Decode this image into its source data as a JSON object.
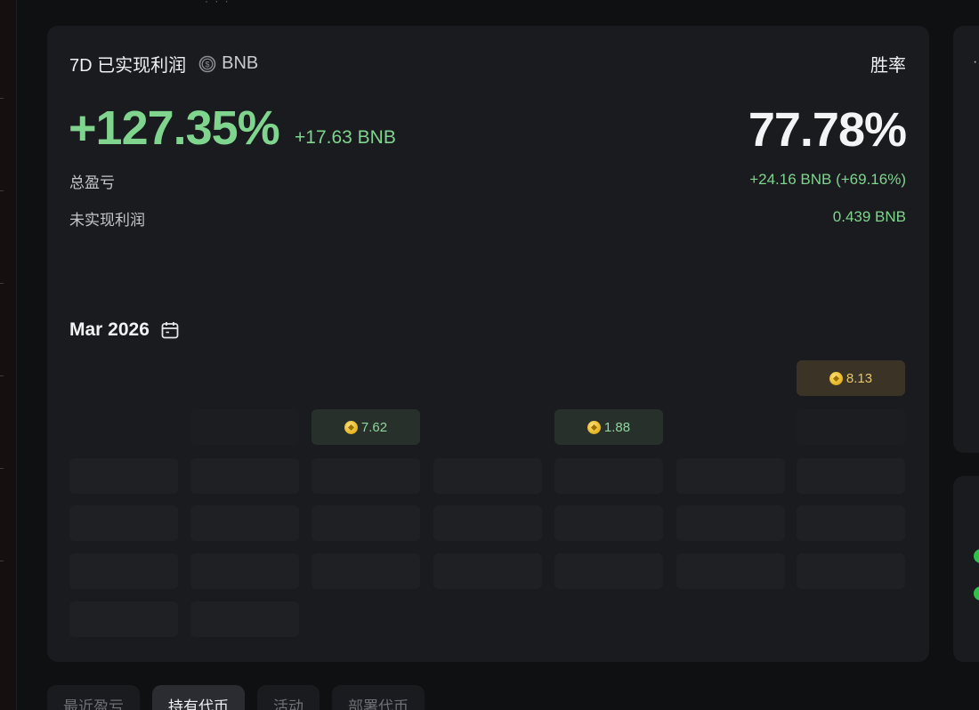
{
  "header": {
    "title": "7D 已实现利润",
    "currency": "BNB",
    "win_rate_label": "胜率"
  },
  "summary": {
    "realized_pct": "+127.35%",
    "realized_amount": "+17.63 BNB",
    "win_rate": "77.78%",
    "total_pnl_label": "总盈亏",
    "total_pnl_value": "+24.16 BNB (+69.16%)",
    "unrealized_label": "未实现利润",
    "unrealized_value": "0.439 BNB"
  },
  "calendar": {
    "month": "Mar 2026",
    "cells": [
      {
        "row": 0,
        "col": 6,
        "value": "8.13",
        "kind": "hi"
      },
      {
        "row": 1,
        "col": 1,
        "value": "",
        "kind": "faint"
      },
      {
        "row": 1,
        "col": 2,
        "value": "7.62",
        "kind": "pos"
      },
      {
        "row": 1,
        "col": 4,
        "value": "1.88",
        "kind": "pos"
      },
      {
        "row": 1,
        "col": 6,
        "value": "",
        "kind": "faint"
      },
      {
        "row": 2,
        "col": 0,
        "value": "",
        "kind": "empty"
      },
      {
        "row": 2,
        "col": 1,
        "value": "",
        "kind": "empty"
      },
      {
        "row": 2,
        "col": 2,
        "value": "",
        "kind": "empty"
      },
      {
        "row": 2,
        "col": 3,
        "value": "",
        "kind": "empty"
      },
      {
        "row": 2,
        "col": 4,
        "value": "",
        "kind": "empty"
      },
      {
        "row": 2,
        "col": 5,
        "value": "",
        "kind": "empty"
      },
      {
        "row": 2,
        "col": 6,
        "value": "",
        "kind": "empty"
      },
      {
        "row": 3,
        "col": 0,
        "value": "",
        "kind": "empty"
      },
      {
        "row": 3,
        "col": 1,
        "value": "",
        "kind": "empty"
      },
      {
        "row": 3,
        "col": 2,
        "value": "",
        "kind": "empty"
      },
      {
        "row": 3,
        "col": 3,
        "value": "",
        "kind": "empty"
      },
      {
        "row": 3,
        "col": 4,
        "value": "",
        "kind": "empty"
      },
      {
        "row": 3,
        "col": 5,
        "value": "",
        "kind": "empty"
      },
      {
        "row": 3,
        "col": 6,
        "value": "",
        "kind": "empty"
      },
      {
        "row": 4,
        "col": 0,
        "value": "",
        "kind": "empty"
      },
      {
        "row": 4,
        "col": 1,
        "value": "",
        "kind": "empty"
      },
      {
        "row": 4,
        "col": 2,
        "value": "",
        "kind": "empty"
      },
      {
        "row": 4,
        "col": 3,
        "value": "",
        "kind": "empty"
      },
      {
        "row": 4,
        "col": 4,
        "value": "",
        "kind": "empty"
      },
      {
        "row": 4,
        "col": 5,
        "value": "",
        "kind": "empty"
      },
      {
        "row": 4,
        "col": 6,
        "value": "",
        "kind": "empty"
      },
      {
        "row": 5,
        "col": 0,
        "value": "",
        "kind": "empty"
      },
      {
        "row": 5,
        "col": 1,
        "value": "",
        "kind": "empty"
      }
    ]
  },
  "tabs": [
    "最近盈亏",
    "持有代币",
    "活动",
    "部署代币"
  ],
  "active_tab": 1,
  "colors": {
    "positive": "#7fd58e",
    "highlight": "#e9c66a",
    "card": "#1a1b1f"
  },
  "icons": {
    "currency_icon": "dollar-coin-icon",
    "calendar_icon": "calendar-icon",
    "cell_icon": "bnb-coin-icon"
  }
}
